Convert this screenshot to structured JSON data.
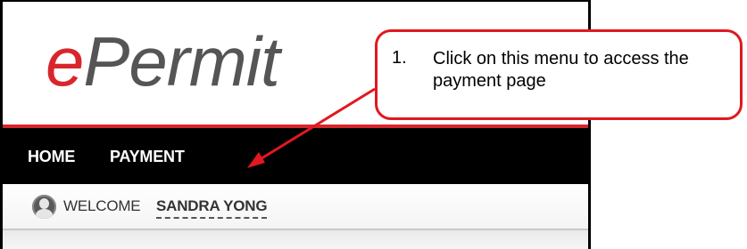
{
  "logo": {
    "e": "e",
    "rest": "Permit"
  },
  "nav": {
    "items": [
      {
        "label": "HOME"
      },
      {
        "label": "PAYMENT"
      }
    ]
  },
  "welcome": {
    "label": "WELCOME",
    "user_name": "SANDRA YONG"
  },
  "callout": {
    "number": "1.",
    "text": "Click on this menu to access the payment page"
  },
  "colors": {
    "brand_red": "#d8262d",
    "callout_red": "#e0191f",
    "navbar": "#000000"
  },
  "icons": {
    "avatar": "user-avatar-icon",
    "arrow": "annotation-arrow-icon"
  }
}
